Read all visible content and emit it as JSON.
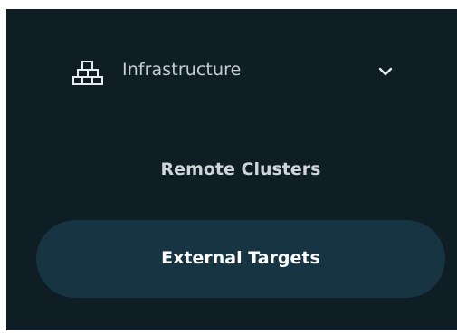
{
  "sidebar": {
    "group": {
      "label": "Infrastructure",
      "icon": "infrastructure-blocks-icon",
      "expanded": true,
      "toggle_icon": "chevron-down-icon"
    },
    "items": [
      {
        "label": "Remote Clusters",
        "active": false
      },
      {
        "label": "External Targets",
        "active": true
      }
    ]
  },
  "colors": {
    "background": "#0f1e25",
    "active_item_bg": "#163442",
    "text": "#c5cdd2",
    "active_text": "#ffffff"
  }
}
